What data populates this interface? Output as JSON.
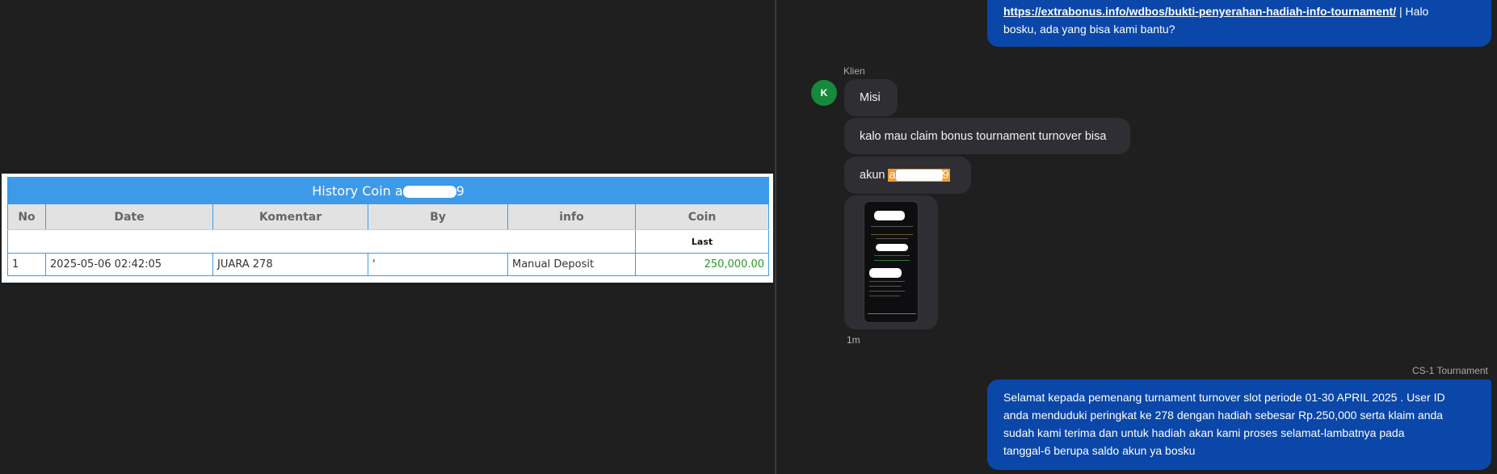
{
  "coin_history": {
    "title_prefix": "History Coin a",
    "title_suffix": "9",
    "columns": [
      "No",
      "Date",
      "Komentar",
      "By",
      "info",
      "Coin"
    ],
    "sub_header": "Last",
    "rows": [
      {
        "no": "1",
        "date": "2025-05-06 02:42:05",
        "komentar": "JUARA 278",
        "by": "'",
        "info": "Manual Deposit",
        "coin": "250,000.00"
      }
    ]
  },
  "chat": {
    "top_message": {
      "link": "https://extrabonus.info/wdbos/bukti-penyerahan-hadiah-info-tournament/",
      "text_line1": "| Halo",
      "text_line2": "bosku, ada yang bisa kami bantu?"
    },
    "client": {
      "sender": "Klien",
      "avatar_initial": "K",
      "messages": [
        "Misi",
        "kalo mau claim bonus tournament turnover bisa"
      ],
      "account_prefix": "akun",
      "account_start": "a",
      "account_end": "9",
      "time": "1m"
    },
    "agent": {
      "sender": "CS-1 Tournament",
      "message_lines": [
        "Selamat kepada pemenang turnament turnover slot periode 01-30 APRIL 2025 . User ID",
        "anda menduduki peringkat ke 278 dengan hadiah sebesar Rp.250,000 serta klaim anda",
        "sudah kami terima dan untuk hadiah akan kami proses selamat-lambatnya pada",
        "tanggal-6 berupa saldo akun ya bosku"
      ]
    }
  }
}
